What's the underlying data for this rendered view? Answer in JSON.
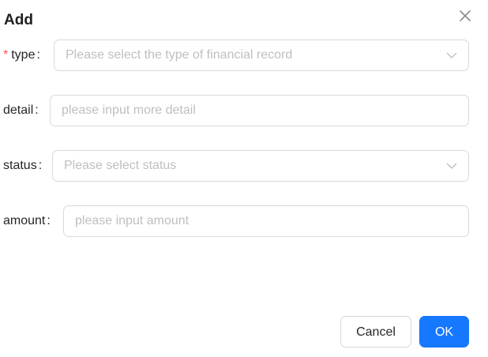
{
  "dialog": {
    "title": "Add"
  },
  "form": {
    "type": {
      "label": "type",
      "required_mark": "*",
      "colon": ":",
      "placeholder": "Please select the type of financial record"
    },
    "detail": {
      "label": "detail",
      "colon": ":",
      "placeholder": "please input more detail"
    },
    "status": {
      "label": "status",
      "colon": ":",
      "placeholder": "Please select status"
    },
    "amount": {
      "label": "amount",
      "colon": ":",
      "placeholder": "please input amount"
    }
  },
  "footer": {
    "cancel_label": "Cancel",
    "ok_label": "OK"
  },
  "colors": {
    "primary": "#1677ff",
    "required": "#ff4d4f",
    "border": "#d9d9d9",
    "placeholder": "#bfbfbf"
  },
  "icons": {
    "close": "close-icon",
    "select_arrow": "chevron-down-icon"
  }
}
